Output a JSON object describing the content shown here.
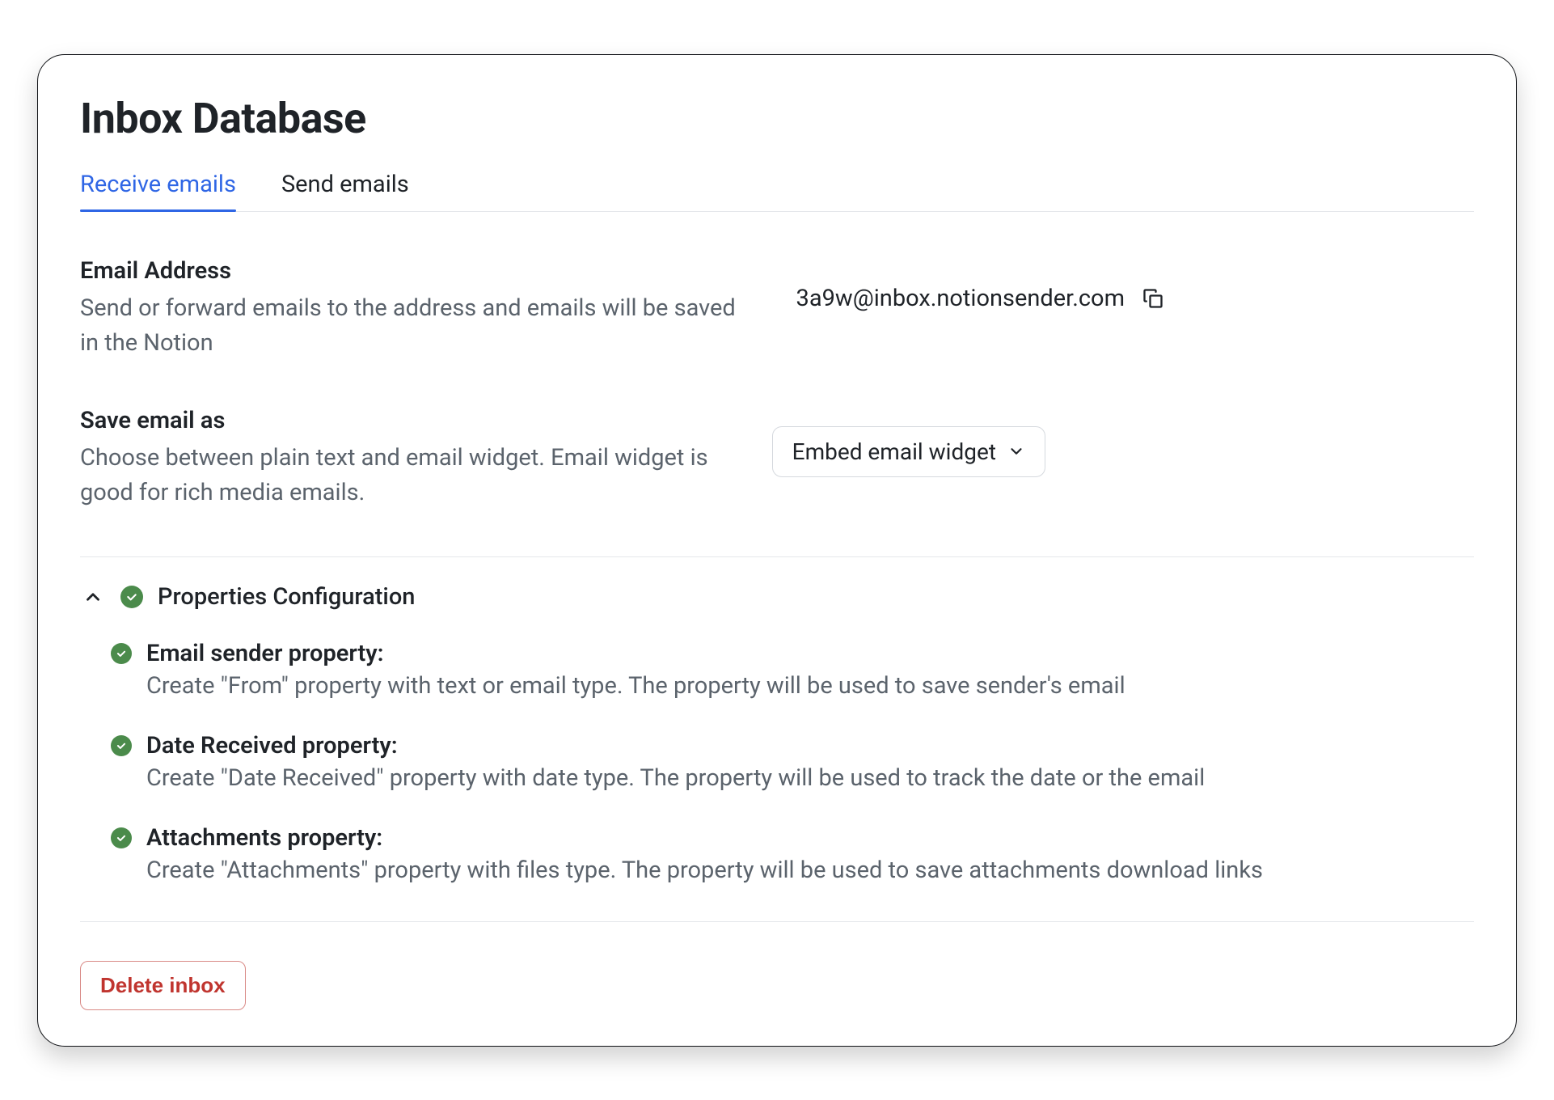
{
  "page": {
    "title": "Inbox Database"
  },
  "tabs": {
    "receive": "Receive emails",
    "send": "Send emails"
  },
  "email_address": {
    "title": "Email Address",
    "description": "Send or forward emails to the address and emails will be saved in the Notion",
    "value": "3a9w@inbox.notionsender.com"
  },
  "save_as": {
    "title": "Save email as",
    "description": "Choose between plain text and email widget. Email widget is good for rich media emails.",
    "selected": "Embed email widget"
  },
  "props_config": {
    "title": "Properties Configuration",
    "items": [
      {
        "title": "Email sender property:",
        "desc": "Create \"From\" property with text or email type. The property will be used to save sender's email"
      },
      {
        "title": "Date Received property:",
        "desc": "Create \"Date Received\" property with date type. The property will be used to track the date or the email"
      },
      {
        "title": "Attachments property:",
        "desc": "Create \"Attachments\" property with files type. The property will be used to save attachments download links"
      }
    ]
  },
  "actions": {
    "delete": "Delete inbox"
  }
}
